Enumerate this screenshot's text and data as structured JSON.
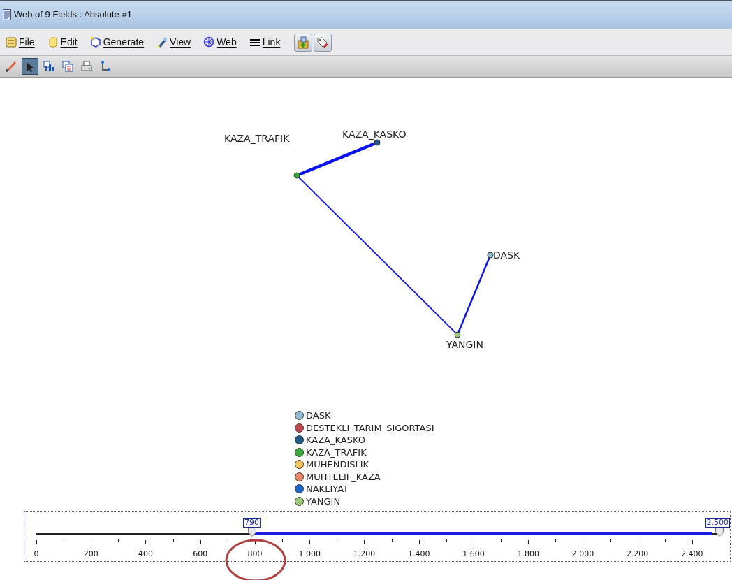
{
  "window": {
    "title": "Web of 9 Fields : Absolute #1"
  },
  "menu": [
    {
      "label": "File"
    },
    {
      "label": "Edit"
    },
    {
      "label": "Generate"
    },
    {
      "label": "View"
    },
    {
      "label": "Web"
    },
    {
      "label": "Link"
    }
  ],
  "toolbar": [
    {
      "selected": false
    },
    {
      "selected": true
    },
    {
      "selected": false
    },
    {
      "selected": false
    },
    {
      "selected": false
    },
    {
      "selected": false
    }
  ],
  "graph": {
    "nodes": [
      {
        "label": "KAZA_TRAFIK",
        "color": "#3aa83a"
      },
      {
        "label": "KAZA_KASKO",
        "color": "#1f5a8a"
      },
      {
        "label": "DASK",
        "color": "#8fbcd4"
      },
      {
        "label": "YANGIN",
        "color": "#98c878"
      }
    ],
    "edges": [
      {
        "kind": "strong"
      },
      {
        "kind": "weak"
      },
      {
        "kind": "medium"
      }
    ]
  },
  "legend": [
    {
      "label": "DASK",
      "color": "#8fbcd4"
    },
    {
      "label": "DESTEKLI_TARIM_SIGORTASI",
      "color": "#c0474a"
    },
    {
      "label": "KAZA_KASKO",
      "color": "#1f5a8a"
    },
    {
      "label": "KAZA_TRAFIK",
      "color": "#3aa83a"
    },
    {
      "label": "MUHENDISLIK",
      "color": "#f5c45a"
    },
    {
      "label": "MUHTELIF_KAZA",
      "color": "#e8876a"
    },
    {
      "label": "NAKLIYAT",
      "color": "#1a66c8"
    },
    {
      "label": "YANGIN",
      "color": "#98c878"
    }
  ],
  "slider": {
    "low": {
      "reading": "790",
      "level": 0.316
    },
    "high": {
      "reading": "2.500",
      "level": 1.0
    },
    "ticks": [
      "0",
      "200",
      "400",
      "600",
      "800",
      "1.000",
      "1.200",
      "1.400",
      "1.600",
      "1.800",
      "2.000",
      "2.200",
      "2.400"
    ]
  }
}
